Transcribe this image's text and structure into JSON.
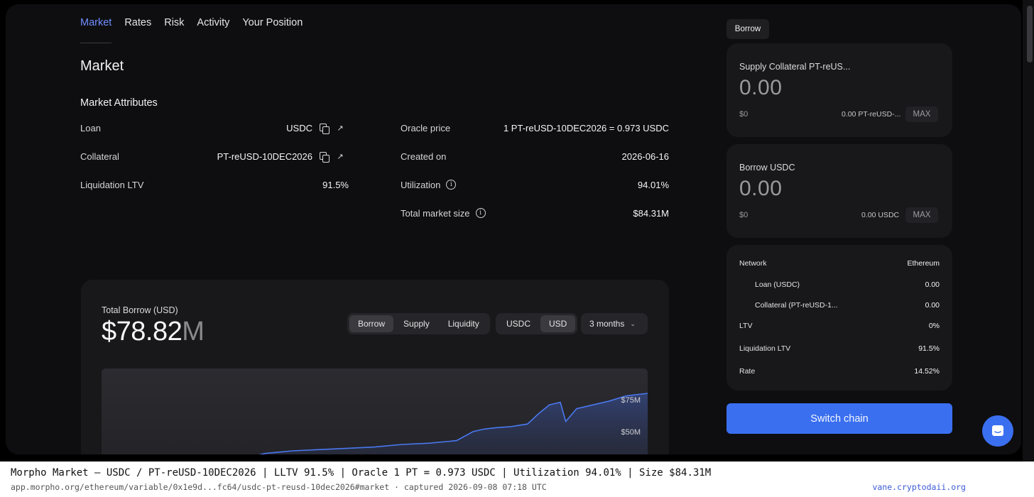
{
  "tabs": [
    "Market",
    "Rates",
    "Risk",
    "Activity",
    "Your Position"
  ],
  "page_title": "Market",
  "attributes_title": "Market Attributes",
  "left_attrs": [
    {
      "label": "Loan",
      "value": "USDC"
    },
    {
      "label": "Collateral",
      "value": "PT-reUSD-10DEC2026"
    },
    {
      "label": "Liquidation LTV",
      "value": "91.5%"
    }
  ],
  "right_attrs": [
    {
      "label": "Oracle price",
      "value": "1 PT-reUSD-10DEC2026 = 0.973 USDC"
    },
    {
      "label": "Created on",
      "value": "2026-06-16"
    },
    {
      "label": "Utilization",
      "value": "94.01%"
    },
    {
      "label": "Total market size",
      "value": "$84.31M"
    }
  ],
  "chart": {
    "label": "Total Borrow (USD)",
    "value_main": "$78.82",
    "value_unit": "M",
    "metric_tabs": [
      "Borrow",
      "Supply",
      "Liquidity"
    ],
    "currency_tabs": [
      "USDC",
      "USD"
    ],
    "range": "3 months",
    "line_color": "#4a78f0"
  },
  "chart_data": {
    "type": "area",
    "title": "Total Borrow (USD)",
    "y_tick_labels": [
      "$75M",
      "$50M"
    ],
    "y_ticks": [
      75,
      50
    ],
    "x": [
      0.0,
      0.05,
      0.1,
      0.15,
      0.2,
      0.25,
      0.3,
      0.35,
      0.4,
      0.45,
      0.5,
      0.55,
      0.6,
      0.65,
      0.68,
      0.7,
      0.72,
      0.75,
      0.78,
      0.8,
      0.82,
      0.84,
      0.85,
      0.87,
      0.9,
      0.93,
      0.96,
      1.0
    ],
    "values": [
      18,
      18,
      18,
      18,
      20,
      28,
      33,
      35,
      36,
      37,
      38,
      40,
      41,
      43,
      50,
      52,
      53,
      54,
      56,
      64,
      71,
      73,
      58,
      68,
      71,
      74,
      78,
      80
    ],
    "ylim": [
      15,
      85
    ]
  },
  "panel": {
    "borrow_tag": "Borrow",
    "supply_title": "Supply Collateral PT-reUS...",
    "supply_amount": "0.00",
    "supply_usd": "$0",
    "supply_balance": "0.00 PT-reUSD-...",
    "borrow_title": "Borrow USDC",
    "borrow_amount": "0.00",
    "borrow_usd": "$0",
    "borrow_balance": "0.00 USDC",
    "max_label": "MAX"
  },
  "summary": {
    "network_label": "Network",
    "network_value": "Ethereum",
    "loan_label": "Loan (USDC)",
    "loan_value": "0.00",
    "collateral_label": "Collateral (PT-reUSD-1...",
    "collateral_value": "0.00",
    "ltv_label": "LTV",
    "ltv_value": "0%",
    "lltv_label": "Liquidation LTV",
    "lltv_value": "91.5%",
    "rate_label": "Rate",
    "rate_value": "14.52%"
  },
  "switch_chain": "Switch chain",
  "caption": {
    "line1": "Morpho Market — USDC / PT-reUSD-10DEC2026  |  LLTV 91.5%  |  Oracle 1 PT = 0.973 USDC  |  Utilization 94.01%  |  Size $84.31M",
    "line2": "app.morpho.org/ethereum/variable/0x1e9d...fc64/usdc-pt-reusd-10dec2026#market   ·   captured 2026-09-08 07:18 UTC",
    "site": "vane.cryptodaii.org"
  }
}
